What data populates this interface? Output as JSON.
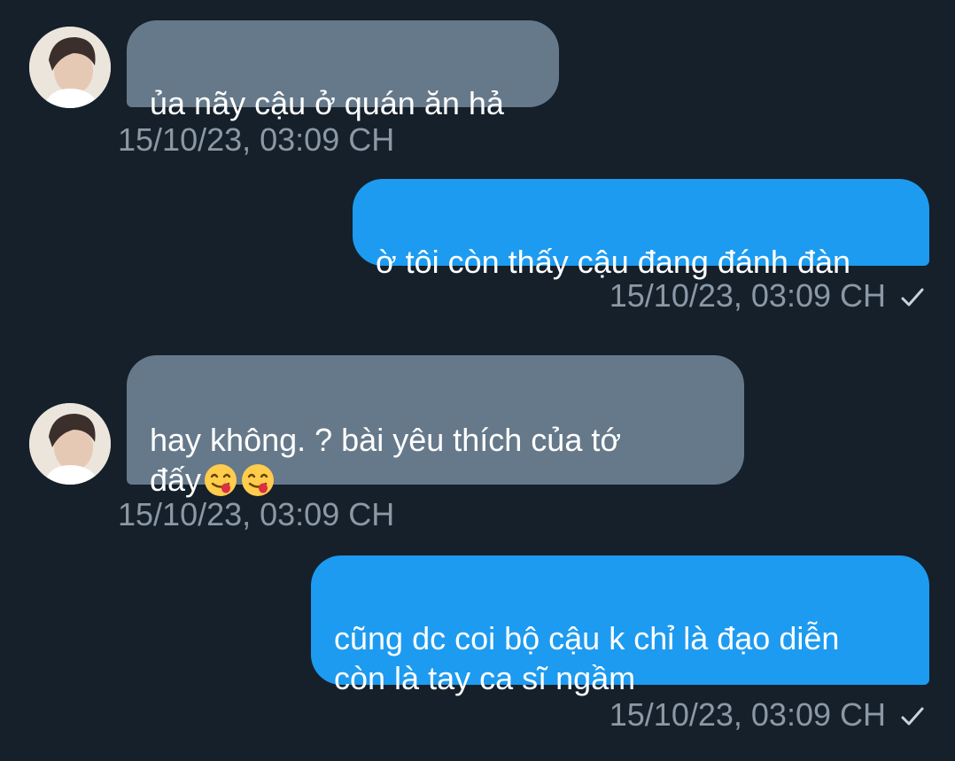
{
  "messages": [
    {
      "direction": "incoming",
      "text": "ủa nãy cậu ở quán ăn hả",
      "timestamp": "15/10/23, 03:09 CH"
    },
    {
      "direction": "outgoing",
      "text": "ờ tôi còn thấy cậu đang đánh đàn",
      "timestamp": "15/10/23, 03:09 CH",
      "status_icon": "checkmark-icon"
    },
    {
      "direction": "incoming",
      "text": "hay không. ? bài yêu thích của tớ\nđấy",
      "emojis": [
        "yum-face-icon",
        "yum-face-icon"
      ],
      "timestamp": "15/10/23, 03:09 CH"
    },
    {
      "direction": "outgoing",
      "text": "cũng dc coi bộ cậu k chỉ là đạo diễn\ncòn là tay ca sĩ ngầm",
      "timestamp": "15/10/23, 03:09 CH",
      "status_icon": "checkmark-icon"
    }
  ],
  "colors": {
    "background": "#15202b",
    "incoming_bubble": "#66798a",
    "outgoing_bubble": "#1d9bf0",
    "timestamp_text": "#8b98a5",
    "message_text": "#ffffff"
  }
}
